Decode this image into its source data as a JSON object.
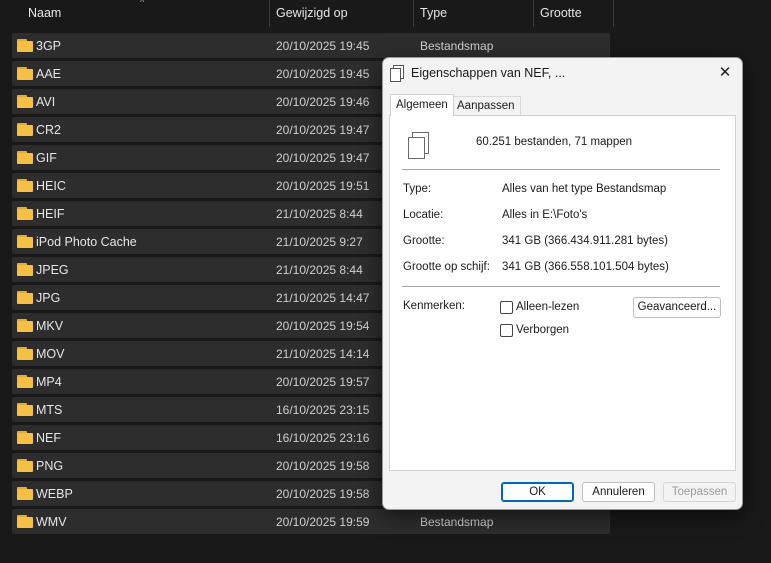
{
  "explorer": {
    "columns": [
      "Naam",
      "Gewijzigd op",
      "Type",
      "Grootte"
    ],
    "rows": [
      {
        "name": "3GP",
        "date": "20/10/2025 19:45",
        "type": "Bestandsmap"
      },
      {
        "name": "AAE",
        "date": "20/10/2025 19:45",
        "type": ""
      },
      {
        "name": "AVI",
        "date": "20/10/2025 19:46",
        "type": ""
      },
      {
        "name": "CR2",
        "date": "20/10/2025 19:47",
        "type": ""
      },
      {
        "name": "GIF",
        "date": "20/10/2025 19:47",
        "type": ""
      },
      {
        "name": "HEIC",
        "date": "20/10/2025 19:51",
        "type": ""
      },
      {
        "name": "HEIF",
        "date": "21/10/2025 8:44",
        "type": ""
      },
      {
        "name": "iPod Photo Cache",
        "date": "21/10/2025 9:27",
        "type": ""
      },
      {
        "name": "JPEG",
        "date": "21/10/2025 8:44",
        "type": ""
      },
      {
        "name": "JPG",
        "date": "21/10/2025 14:47",
        "type": ""
      },
      {
        "name": "MKV",
        "date": "20/10/2025 19:54",
        "type": ""
      },
      {
        "name": "MOV",
        "date": "21/10/2025 14:14",
        "type": ""
      },
      {
        "name": "MP4",
        "date": "20/10/2025 19:57",
        "type": ""
      },
      {
        "name": "MTS",
        "date": "16/10/2025 23:15",
        "type": ""
      },
      {
        "name": "NEF",
        "date": "16/10/2025 23:16",
        "type": ""
      },
      {
        "name": "PNG",
        "date": "20/10/2025 19:58",
        "type": ""
      },
      {
        "name": "WEBP",
        "date": "20/10/2025 19:58",
        "type": ""
      },
      {
        "name": "WMV",
        "date": "20/10/2025 19:59",
        "type": "Bestandsmap"
      }
    ]
  },
  "dialog": {
    "title": "Eigenschappen van NEF, ...",
    "tabs": [
      "Algemeen",
      "Aanpassen"
    ],
    "summary": "60.251 bestanden, 71 mappen",
    "props": [
      {
        "label": "Type:",
        "value": "Alles van het type Bestandsmap"
      },
      {
        "label": "Locatie:",
        "value": "Alles in E:\\Foto's"
      },
      {
        "label": "Grootte:",
        "value": "341 GB (366.434.911.281 bytes)"
      },
      {
        "label": "Grootte op schijf:",
        "value": "341 GB (366.558.101.504 bytes)"
      }
    ],
    "attributes_label": "Kenmerken:",
    "readonly_label": "Alleen-lezen",
    "hidden_label": "Verborgen",
    "advanced_label": "Geavanceerd...",
    "ok_label": "OK",
    "cancel_label": "Annuleren",
    "apply_label": "Toepassen"
  }
}
